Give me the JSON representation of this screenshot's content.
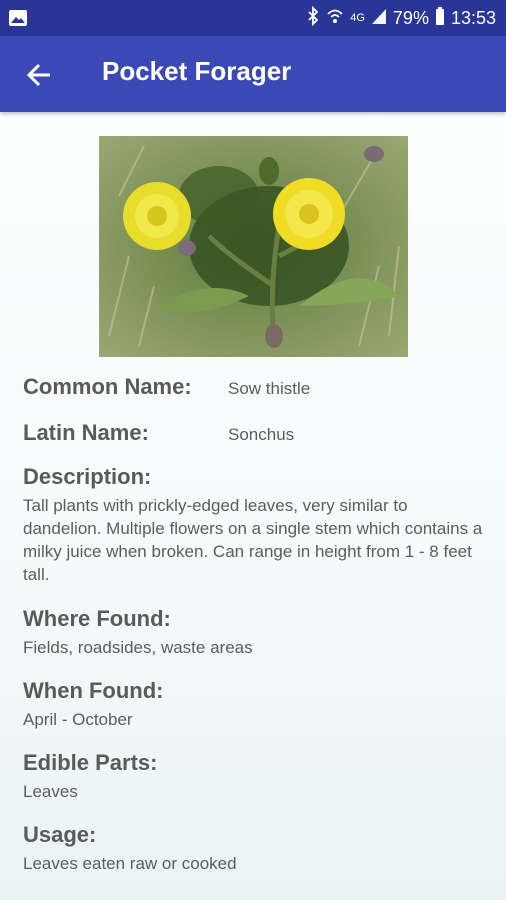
{
  "status_bar": {
    "battery": "79%",
    "time": "13:53",
    "network": "4G",
    "icons": [
      "gallery-icon",
      "bluetooth-icon",
      "wifi-icon",
      "signal-icon",
      "battery-icon"
    ]
  },
  "toolbar": {
    "title": "Pocket Forager",
    "back_icon": "arrow-left-icon"
  },
  "plant": {
    "photo_subject": "sow thistle flowers",
    "common_name_label": "Common Name:",
    "common_name": "Sow thistle",
    "latin_name_label": "Latin Name:",
    "latin_name": "Sonchus",
    "description_label": "Description:",
    "description": "Tall plants with prickly-edged leaves, very similar to dandelion. Multiple flowers on a single stem which contains a milky juice when broken. Can range in height from 1 - 8 feet tall.",
    "where_label": "Where Found:",
    "where": "Fields, roadsides, waste areas",
    "when_label": "When Found:",
    "when": "April - October",
    "edible_label": "Edible Parts:",
    "edible": "Leaves",
    "usage_label": "Usage:",
    "usage": "Leaves eaten raw or cooked"
  },
  "colors": {
    "status_bar": "#293597",
    "toolbar": "#3b49b6",
    "label_text": "#5a5a5a",
    "value_text": "#5c5c5c"
  }
}
